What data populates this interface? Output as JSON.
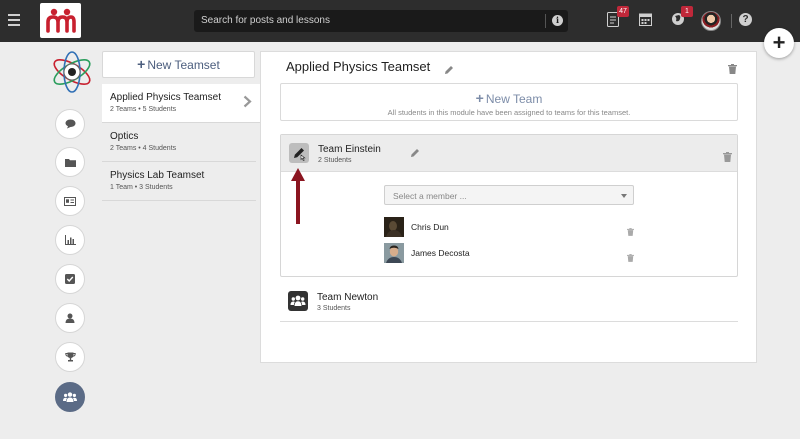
{
  "topbar": {
    "search_placeholder": "Search for posts and lessons",
    "notifications_count": "47",
    "globe_count": "1"
  },
  "sidebar": {
    "new_teamset_label": "New Teamset",
    "teamsets": [
      {
        "name": "Applied Physics Teamset",
        "meta": "2 Teams • 5 Students"
      },
      {
        "name": "Optics",
        "meta": "2 Teams • 4 Students"
      },
      {
        "name": "Physics Lab Teamset",
        "meta": "1 Team • 3 Students"
      }
    ]
  },
  "main": {
    "title": "Applied Physics Teamset",
    "new_team_label": "New Team",
    "new_team_note": "All students in this module have been assigned to teams for this teamset.",
    "teams": [
      {
        "name": "Team Einstein",
        "meta": "2 Students",
        "select_placeholder": "Select a member ...",
        "members": [
          "Chris Dun",
          "James Decosta"
        ]
      },
      {
        "name": "Team Newton",
        "meta": "3 Students"
      }
    ]
  },
  "colors": {
    "topbar": "#2d2d2d",
    "accent": "#4c5e7e",
    "badge": "#c0283a",
    "arrow": "#8b1520"
  }
}
